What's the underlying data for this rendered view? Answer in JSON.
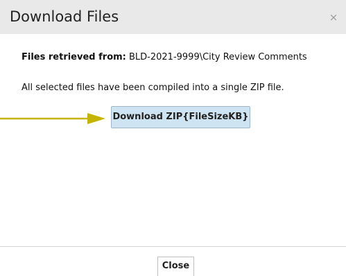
{
  "dialog": {
    "title": "Download Files",
    "close_glyph": "×"
  },
  "content": {
    "retrieved_label": "Files retrieved from:",
    "retrieved_path": " BLD-2021-9999\\City Review Comments",
    "message": "All selected files have been compiled into a single ZIP file."
  },
  "download_button": {
    "label": "Download ZIP{FileSizeKB}"
  },
  "footer": {
    "close_label": "Close"
  },
  "colors": {
    "titlebar": "#e9e9e9",
    "button_fill": "#cfe4f3",
    "arrow": "#c4b400"
  },
  "icons": {
    "close": "close-icon",
    "pointer": "arrow-right-icon"
  }
}
